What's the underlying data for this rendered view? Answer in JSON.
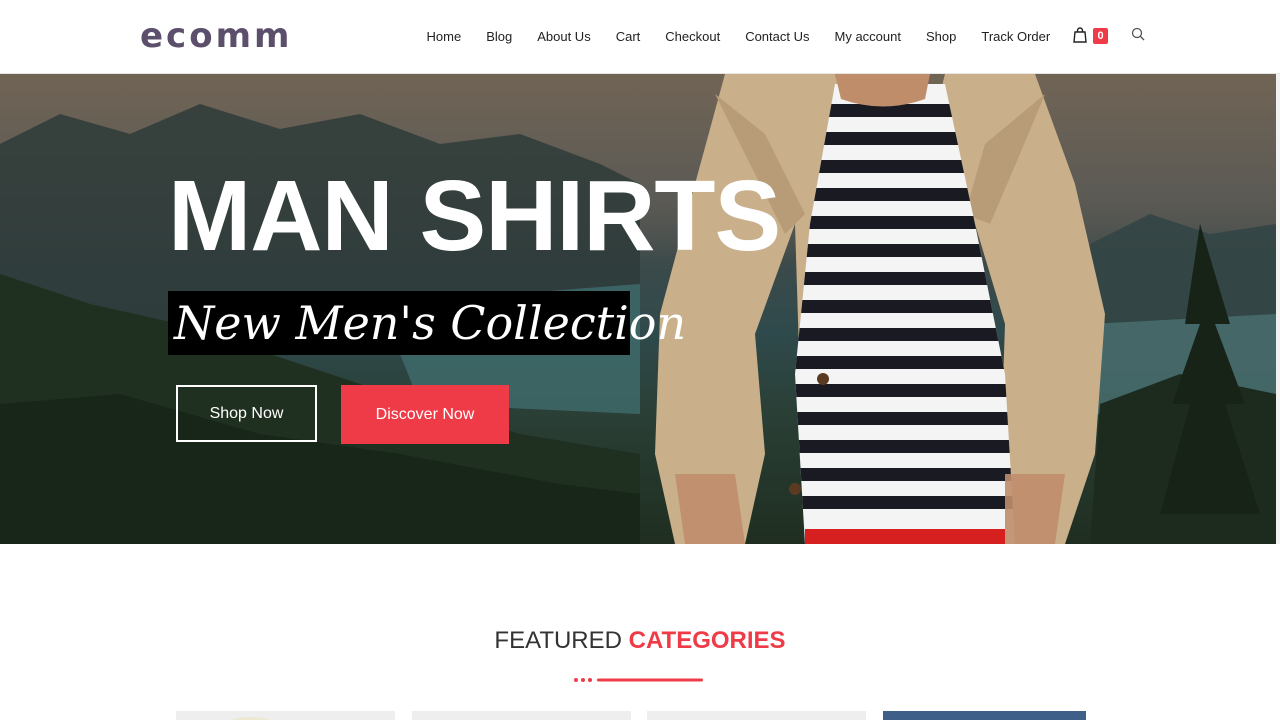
{
  "brand": {
    "logo": "ecomm"
  },
  "nav": {
    "items": [
      "Home",
      "Blog",
      "About Us",
      "Cart",
      "Checkout",
      "Contact Us",
      "My account",
      "Shop",
      "Track Order"
    ]
  },
  "cart": {
    "count": "0",
    "icon": "shopping-bag-icon"
  },
  "search": {
    "icon": "search-icon"
  },
  "hero": {
    "title": "MAN SHIRTS",
    "subtitle": "New Men's Collection",
    "primary_button": "Shop Now",
    "secondary_button": "Discover Now"
  },
  "featured": {
    "title_part1": "FEATURED ",
    "title_part2": "CATEGORIES"
  },
  "colors": {
    "accent": "#ef3b47",
    "logo": "#5b4f6b",
    "text": "#222222"
  }
}
